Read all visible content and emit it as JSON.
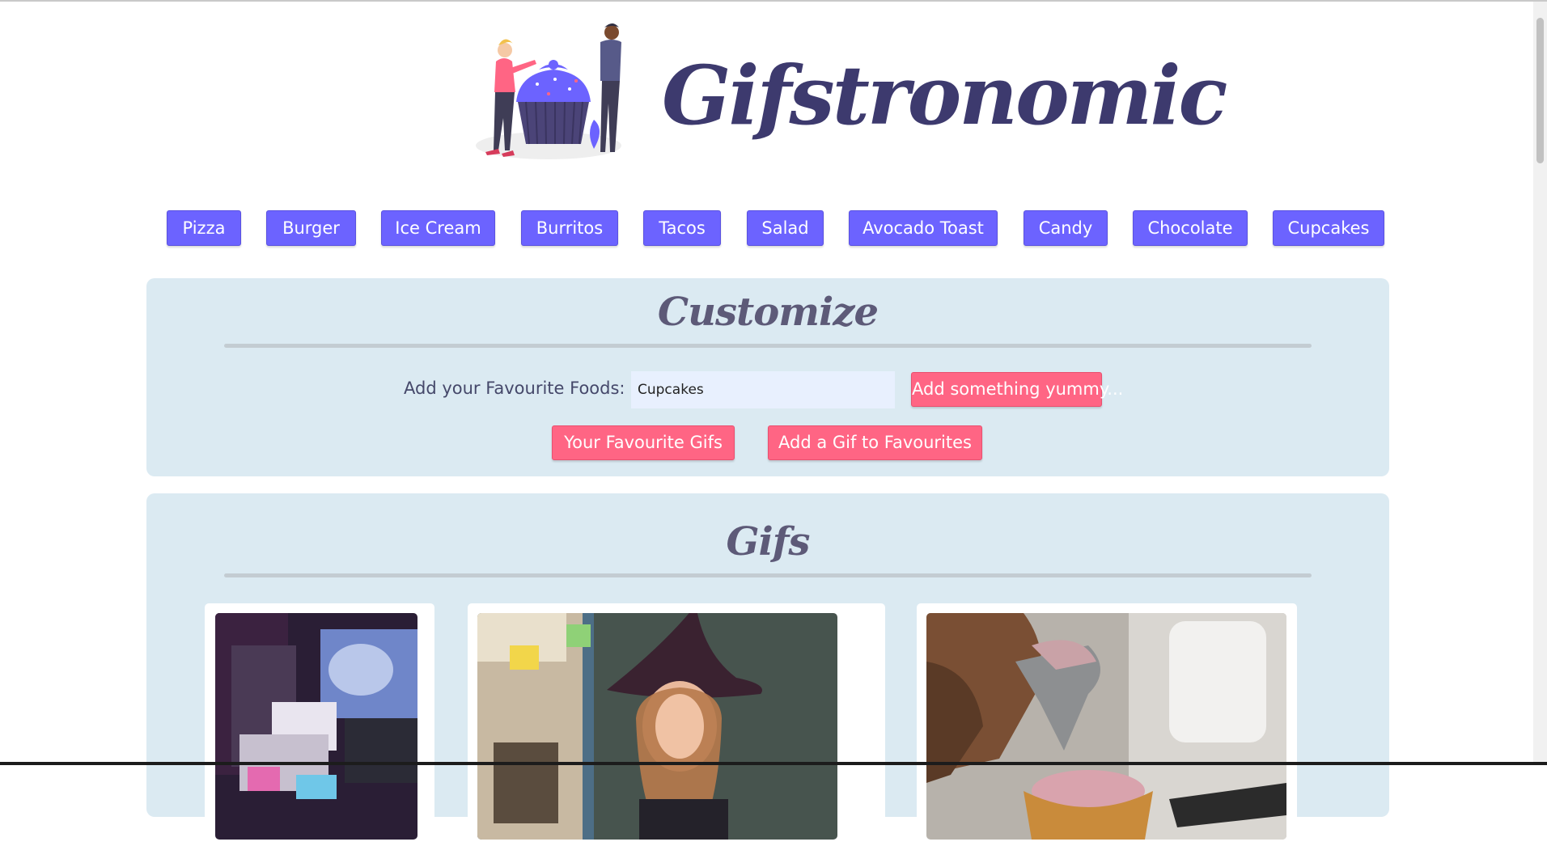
{
  "header": {
    "title": "Gifstronomic"
  },
  "food_nav": {
    "items": [
      {
        "label": "Pizza"
      },
      {
        "label": "Burger"
      },
      {
        "label": "Ice Cream"
      },
      {
        "label": "Burritos"
      },
      {
        "label": "Tacos"
      },
      {
        "label": "Salad"
      },
      {
        "label": "Avocado Toast"
      },
      {
        "label": "Candy"
      },
      {
        "label": "Chocolate"
      },
      {
        "label": "Cupcakes"
      }
    ]
  },
  "customize": {
    "heading": "Customize",
    "favourite_label": "Add your Favourite Foods:",
    "favourite_input_value": "Cupcakes",
    "add_button": "Add something yummy...",
    "favourite_gifs_button": "Your Favourite Gifs",
    "add_gif_button": "Add a Gif to Favourites"
  },
  "gifs": {
    "heading": "Gifs"
  },
  "colors": {
    "primary_purple": "#6c63ff",
    "accent_pink": "#ff6584",
    "panel_bg": "#dbeaf2",
    "title_color": "#3d3a6e"
  }
}
